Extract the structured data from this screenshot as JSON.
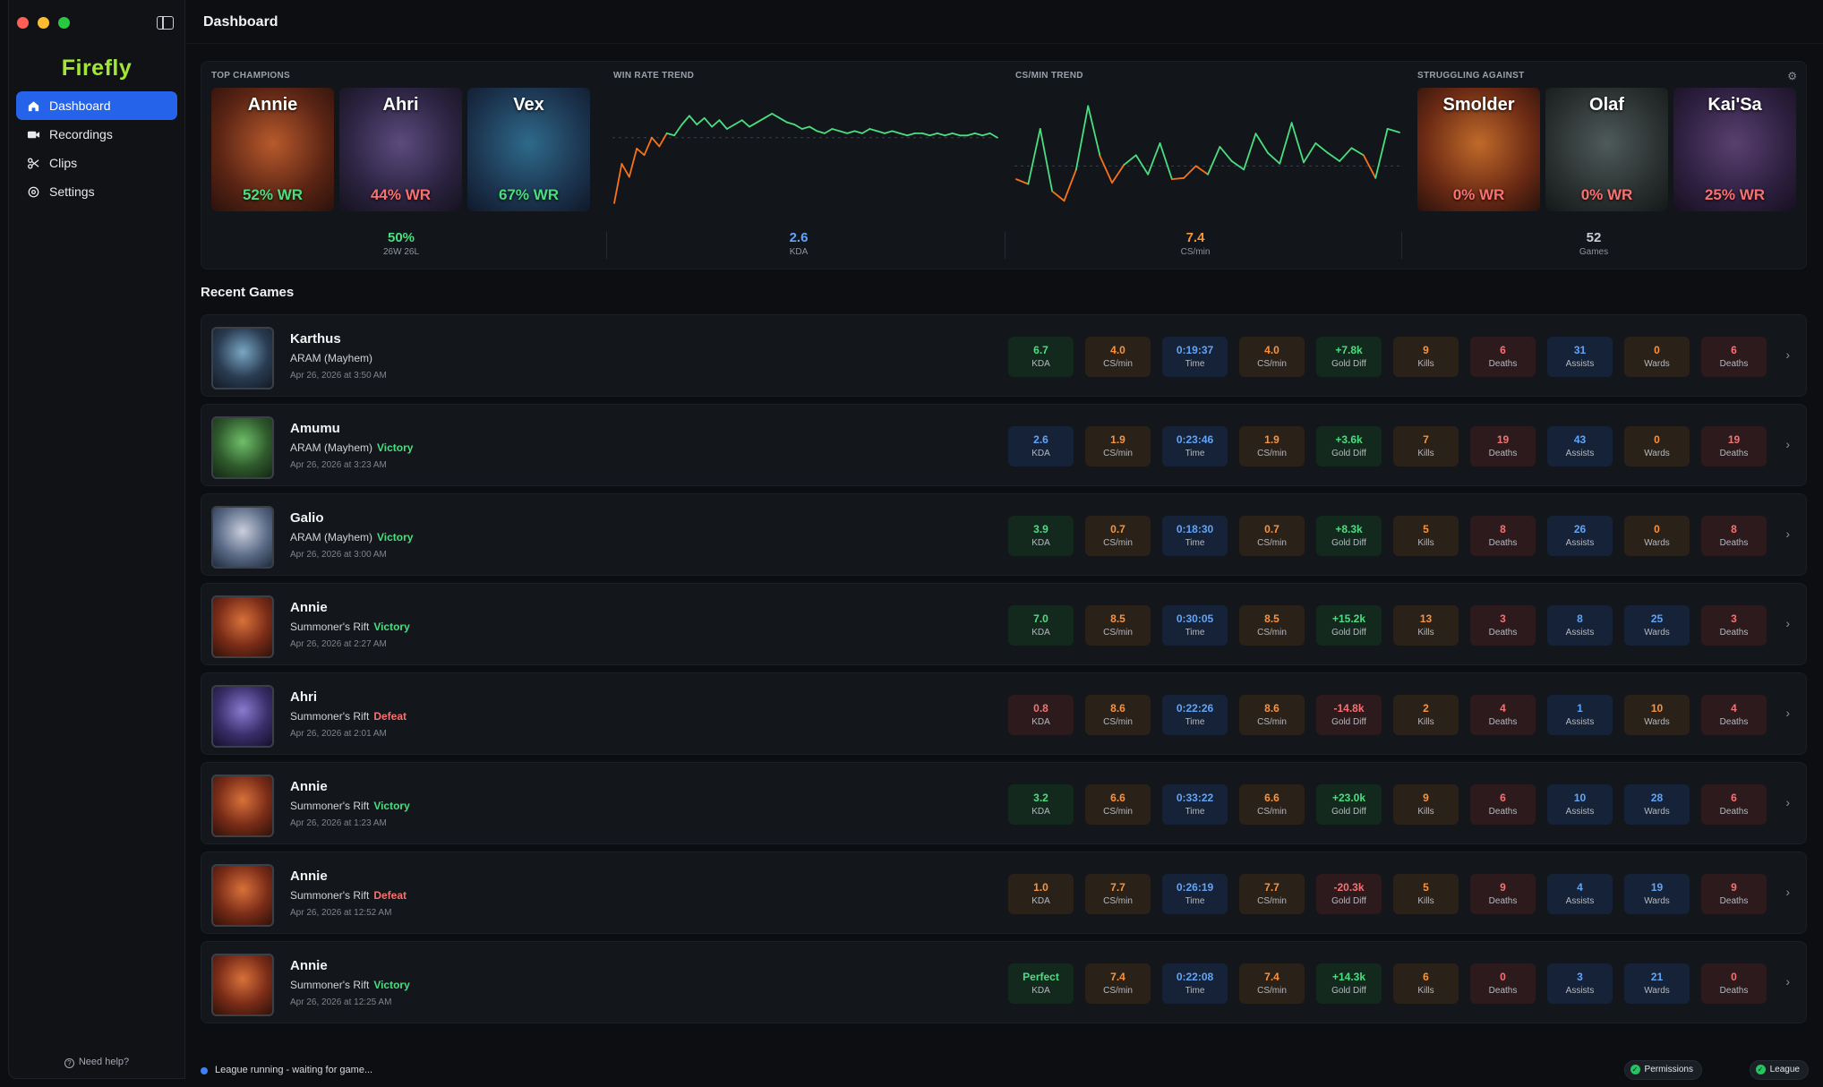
{
  "app": {
    "logo": "Firefly",
    "help": "Need help?"
  },
  "sidebar": {
    "items": [
      {
        "label": "Dashboard",
        "icon": "home-icon"
      },
      {
        "label": "Recordings",
        "icon": "video-camera-icon"
      },
      {
        "label": "Clips",
        "icon": "scissors-icon"
      },
      {
        "label": "Settings",
        "icon": "gear-icon"
      }
    ]
  },
  "header": {
    "title": "Dashboard"
  },
  "overview": {
    "top_champions_label": "TOP CHAMPIONS",
    "win_rate_trend_label": "WIN RATE TREND",
    "cs_trend_label": "CS/MIN TREND",
    "struggling_label": "STRUGGLING AGAINST",
    "top_champions": [
      {
        "name": "Annie",
        "wr": "52% WR",
        "wr_color": "#4ade80"
      },
      {
        "name": "Ahri",
        "wr": "44% WR",
        "wr_color": "#f87171"
      },
      {
        "name": "Vex",
        "wr": "67% WR",
        "wr_color": "#4ade80"
      }
    ],
    "struggling": [
      {
        "name": "Smolder",
        "wr": "0% WR",
        "wr_color": "#f87171"
      },
      {
        "name": "Olaf",
        "wr": "0% WR",
        "wr_color": "#f87171"
      },
      {
        "name": "Kai'Sa",
        "wr": "25% WR",
        "wr_color": "#f87171"
      }
    ],
    "stats": [
      {
        "value": "50%",
        "label": "26W 26L",
        "color": "#4ade80"
      },
      {
        "value": "2.6",
        "label": "KDA",
        "color": "#60a5fa"
      },
      {
        "value": "7.4",
        "label": "CS/min",
        "color": "#fb923c"
      },
      {
        "value": "52",
        "label": "Games",
        "color": "#c9ccd2"
      }
    ],
    "win_rate_trend": [
      20,
      38,
      32,
      45,
      42,
      50,
      46,
      52,
      51,
      56,
      60,
      56,
      59,
      55,
      58,
      54,
      56,
      58,
      55,
      57,
      59,
      61,
      59,
      57,
      56,
      54,
      55,
      53,
      52,
      54,
      53,
      52,
      53,
      52,
      54,
      53,
      52,
      53,
      52,
      51,
      52,
      52,
      51,
      52,
      51,
      52,
      51,
      51,
      52,
      51,
      52,
      50
    ],
    "cs_trend": [
      8.4,
      8.0,
      12.6,
      7.4,
      6.6,
      9.2,
      14.5,
      10.3,
      8.1,
      9.6,
      10.4,
      8.8,
      11.4,
      8.4,
      8.5,
      9.5,
      8.8,
      11.1,
      9.9,
      9.2,
      12.2,
      10.6,
      9.7,
      13.1,
      9.8,
      11.4,
      10.6,
      9.9,
      11.0,
      10.4,
      8.5,
      12.6,
      12.3
    ]
  },
  "recent": {
    "title": "Recent Games",
    "games": [
      {
        "champion": "Karthus",
        "mode": "ARAM (Mayhem)",
        "result": "",
        "result_color": "",
        "date": "Apr 26, 2026 at 3:50 AM",
        "stats": [
          {
            "v": "6.7",
            "l": "KDA",
            "c": "green"
          },
          {
            "v": "4.0",
            "l": "CS/min",
            "c": "orange"
          },
          {
            "v": "0:19:37",
            "l": "Time",
            "c": "blue"
          },
          {
            "v": "4.0",
            "l": "CS/min",
            "c": "orange"
          },
          {
            "v": "+7.8k",
            "l": "Gold Diff",
            "c": "green"
          },
          {
            "v": "9",
            "l": "Kills",
            "c": "orange"
          },
          {
            "v": "6",
            "l": "Deaths",
            "c": "red"
          },
          {
            "v": "31",
            "l": "Assists",
            "c": "blue"
          },
          {
            "v": "0",
            "l": "Wards",
            "c": "orange"
          },
          {
            "v": "6",
            "l": "Deaths",
            "c": "red"
          }
        ]
      },
      {
        "champion": "Amumu",
        "mode": "ARAM (Mayhem)",
        "result": "Victory",
        "result_color": "#4ade80",
        "date": "Apr 26, 2026 at 3:23 AM",
        "stats": [
          {
            "v": "2.6",
            "l": "KDA",
            "c": "blue"
          },
          {
            "v": "1.9",
            "l": "CS/min",
            "c": "orange"
          },
          {
            "v": "0:23:46",
            "l": "Time",
            "c": "blue"
          },
          {
            "v": "1.9",
            "l": "CS/min",
            "c": "orange"
          },
          {
            "v": "+3.6k",
            "l": "Gold Diff",
            "c": "green"
          },
          {
            "v": "7",
            "l": "Kills",
            "c": "orange"
          },
          {
            "v": "19",
            "l": "Deaths",
            "c": "red"
          },
          {
            "v": "43",
            "l": "Assists",
            "c": "blue"
          },
          {
            "v": "0",
            "l": "Wards",
            "c": "orange"
          },
          {
            "v": "19",
            "l": "Deaths",
            "c": "red"
          }
        ]
      },
      {
        "champion": "Galio",
        "mode": "ARAM (Mayhem)",
        "result": "Victory",
        "result_color": "#4ade80",
        "date": "Apr 26, 2026 at 3:00 AM",
        "stats": [
          {
            "v": "3.9",
            "l": "KDA",
            "c": "green"
          },
          {
            "v": "0.7",
            "l": "CS/min",
            "c": "orange"
          },
          {
            "v": "0:18:30",
            "l": "Time",
            "c": "blue"
          },
          {
            "v": "0.7",
            "l": "CS/min",
            "c": "orange"
          },
          {
            "v": "+8.3k",
            "l": "Gold Diff",
            "c": "green"
          },
          {
            "v": "5",
            "l": "Kills",
            "c": "orange"
          },
          {
            "v": "8",
            "l": "Deaths",
            "c": "red"
          },
          {
            "v": "26",
            "l": "Assists",
            "c": "blue"
          },
          {
            "v": "0",
            "l": "Wards",
            "c": "orange"
          },
          {
            "v": "8",
            "l": "Deaths",
            "c": "red"
          }
        ]
      },
      {
        "champion": "Annie",
        "mode": "Summoner's Rift",
        "result": "Victory",
        "result_color": "#4ade80",
        "date": "Apr 26, 2026 at 2:27 AM",
        "stats": [
          {
            "v": "7.0",
            "l": "KDA",
            "c": "green"
          },
          {
            "v": "8.5",
            "l": "CS/min",
            "c": "orange"
          },
          {
            "v": "0:30:05",
            "l": "Time",
            "c": "blue"
          },
          {
            "v": "8.5",
            "l": "CS/min",
            "c": "orange"
          },
          {
            "v": "+15.2k",
            "l": "Gold Diff",
            "c": "green"
          },
          {
            "v": "13",
            "l": "Kills",
            "c": "orange"
          },
          {
            "v": "3",
            "l": "Deaths",
            "c": "red"
          },
          {
            "v": "8",
            "l": "Assists",
            "c": "blue"
          },
          {
            "v": "25",
            "l": "Wards",
            "c": "blue"
          },
          {
            "v": "3",
            "l": "Deaths",
            "c": "red"
          }
        ]
      },
      {
        "champion": "Ahri",
        "mode": "Summoner's Rift",
        "result": "Defeat",
        "result_color": "#f87171",
        "date": "Apr 26, 2026 at 2:01 AM",
        "stats": [
          {
            "v": "0.8",
            "l": "KDA",
            "c": "red"
          },
          {
            "v": "8.6",
            "l": "CS/min",
            "c": "orange"
          },
          {
            "v": "0:22:26",
            "l": "Time",
            "c": "blue"
          },
          {
            "v": "8.6",
            "l": "CS/min",
            "c": "orange"
          },
          {
            "v": "-14.8k",
            "l": "Gold Diff",
            "c": "red"
          },
          {
            "v": "2",
            "l": "Kills",
            "c": "orange"
          },
          {
            "v": "4",
            "l": "Deaths",
            "c": "red"
          },
          {
            "v": "1",
            "l": "Assists",
            "c": "blue"
          },
          {
            "v": "10",
            "l": "Wards",
            "c": "orange"
          },
          {
            "v": "4",
            "l": "Deaths",
            "c": "red"
          }
        ]
      },
      {
        "champion": "Annie",
        "mode": "Summoner's Rift",
        "result": "Victory",
        "result_color": "#4ade80",
        "date": "Apr 26, 2026 at 1:23 AM",
        "stats": [
          {
            "v": "3.2",
            "l": "KDA",
            "c": "green"
          },
          {
            "v": "6.6",
            "l": "CS/min",
            "c": "orange"
          },
          {
            "v": "0:33:22",
            "l": "Time",
            "c": "blue"
          },
          {
            "v": "6.6",
            "l": "CS/min",
            "c": "orange"
          },
          {
            "v": "+23.0k",
            "l": "Gold Diff",
            "c": "green"
          },
          {
            "v": "9",
            "l": "Kills",
            "c": "orange"
          },
          {
            "v": "6",
            "l": "Deaths",
            "c": "red"
          },
          {
            "v": "10",
            "l": "Assists",
            "c": "blue"
          },
          {
            "v": "28",
            "l": "Wards",
            "c": "blue"
          },
          {
            "v": "6",
            "l": "Deaths",
            "c": "red"
          }
        ]
      },
      {
        "champion": "Annie",
        "mode": "Summoner's Rift",
        "result": "Defeat",
        "result_color": "#f87171",
        "date": "Apr 26, 2026 at 12:52 AM",
        "stats": [
          {
            "v": "1.0",
            "l": "KDA",
            "c": "orange"
          },
          {
            "v": "7.7",
            "l": "CS/min",
            "c": "orange"
          },
          {
            "v": "0:26:19",
            "l": "Time",
            "c": "blue"
          },
          {
            "v": "7.7",
            "l": "CS/min",
            "c": "orange"
          },
          {
            "v": "-20.3k",
            "l": "Gold Diff",
            "c": "red"
          },
          {
            "v": "5",
            "l": "Kills",
            "c": "orange"
          },
          {
            "v": "9",
            "l": "Deaths",
            "c": "red"
          },
          {
            "v": "4",
            "l": "Assists",
            "c": "blue"
          },
          {
            "v": "19",
            "l": "Wards",
            "c": "blue"
          },
          {
            "v": "9",
            "l": "Deaths",
            "c": "red"
          }
        ]
      },
      {
        "champion": "Annie",
        "mode": "Summoner's Rift",
        "result": "Victory",
        "result_color": "#4ade80",
        "date": "Apr 26, 2026 at 12:25 AM",
        "stats": [
          {
            "v": "Perfect",
            "l": "KDA",
            "c": "green"
          },
          {
            "v": "7.4",
            "l": "CS/min",
            "c": "orange"
          },
          {
            "v": "0:22:08",
            "l": "Time",
            "c": "blue"
          },
          {
            "v": "7.4",
            "l": "CS/min",
            "c": "orange"
          },
          {
            "v": "+14.3k",
            "l": "Gold Diff",
            "c": "green"
          },
          {
            "v": "6",
            "l": "Kills",
            "c": "orange"
          },
          {
            "v": "0",
            "l": "Deaths",
            "c": "red"
          },
          {
            "v": "3",
            "l": "Assists",
            "c": "blue"
          },
          {
            "v": "21",
            "l": "Wards",
            "c": "blue"
          },
          {
            "v": "0",
            "l": "Deaths",
            "c": "red"
          }
        ]
      }
    ]
  },
  "status": {
    "text": "League running - waiting for game...",
    "permissions": "Permissions",
    "league": "League"
  },
  "colors": {
    "accent": "#2563eb",
    "logo": "#a3e635",
    "win": "#4ade80",
    "loss": "#f87171"
  }
}
